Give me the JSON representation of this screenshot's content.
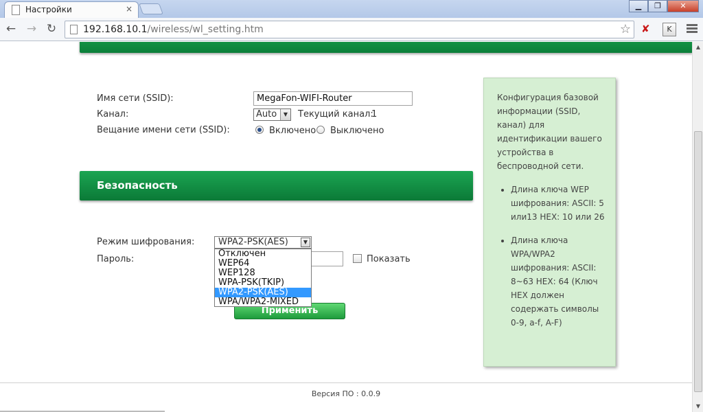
{
  "browser": {
    "tab_title": "Настройки",
    "tab_close": "×",
    "url_host": "192.168.10.1",
    "url_path": "/wireless/wl_setting.htm",
    "back": "←",
    "forward": "→",
    "reload": "↻",
    "star": "☆",
    "ext_kaspersky": "K",
    "window_minimize": "▁",
    "window_restore": "❐",
    "window_close": "✕"
  },
  "wireless": {
    "ssid_label": "Имя сети (SSID):",
    "ssid_value": "MegaFon-WIFI-Router",
    "channel_label": "Канал:",
    "channel_value": "Auto",
    "current_channel_label": "Текущий канал:",
    "current_channel_value": "1",
    "broadcast_label": "Вещание имени сети (SSID):",
    "broadcast_on": "Включено",
    "broadcast_off": "Выключено",
    "broadcast_selected": "on"
  },
  "security": {
    "title": "Безопасность",
    "encryption_label": "Режим шифрования:",
    "encryption_value": "WPA2-PSK(AES)",
    "encryption_options": [
      "Отключен",
      "WEP64",
      "WEP128",
      "WPA-PSK(TKIP)",
      "WPA2-PSK(AES)",
      "WPA/WPA2-MIXED"
    ],
    "password_label": "Пароль:",
    "password_value": "",
    "show_label": "Показать",
    "apply_label": "Применить"
  },
  "info": {
    "intro": "Конфигурация базовой информации (SSID, канал) для идентификации вашего устройства в беспроводной сети.",
    "wep_note": "Длина ключа WEP шифрования: ASCII: 5 или13 HEX: 10 или 26",
    "wpa_note": "Длина ключа WPA/WPA2 шифрования: ASCII: 8~63 HEX: 64 (Ключ HEX должен содержать символы 0-9, a-f, A-F)"
  },
  "footer": {
    "version": "Версия ПО : 0.0.9"
  },
  "colors": {
    "accent_green": "#0c7f3a",
    "info_bg": "#d6efd3",
    "select_highlight": "#3399ff"
  }
}
